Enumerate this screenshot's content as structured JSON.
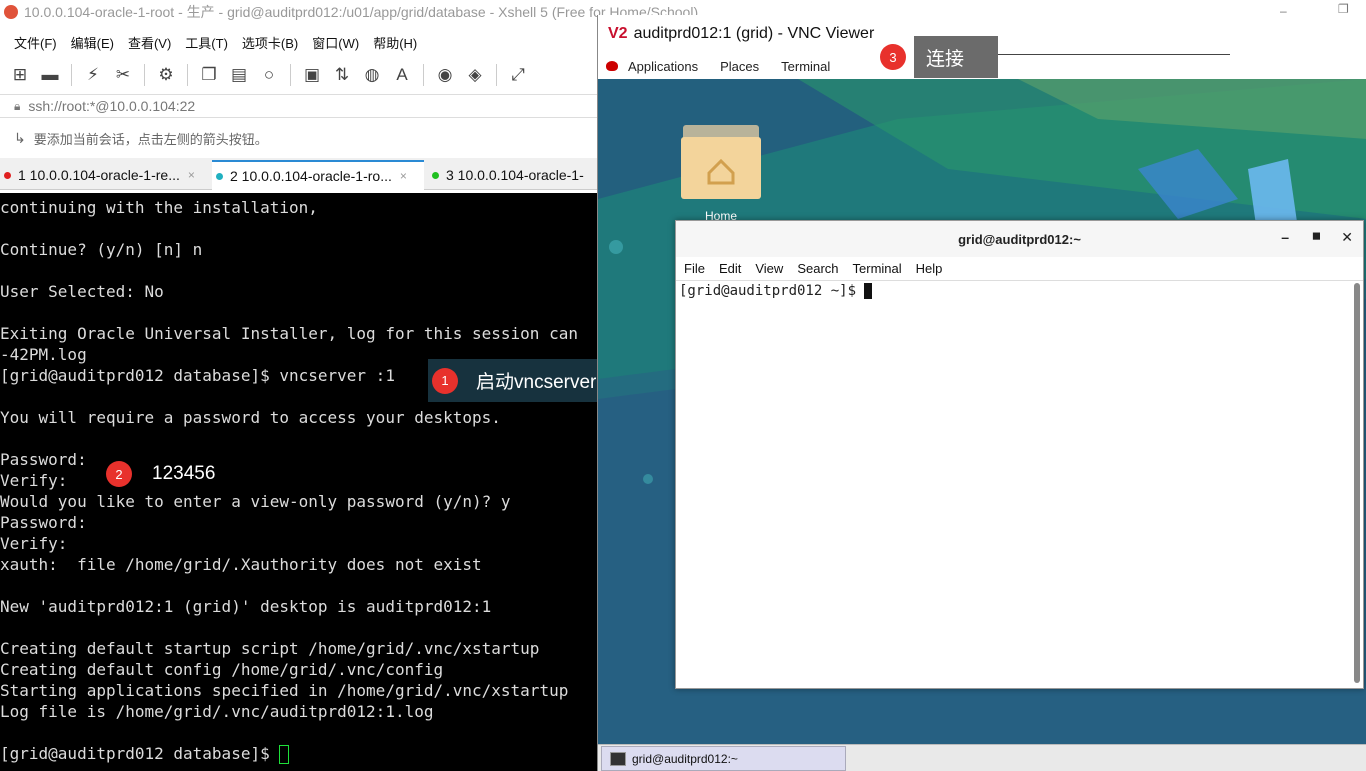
{
  "xshell": {
    "title": "10.0.0.104-oracle-1-root - 生产 - grid@auditprd012:/u01/app/grid/database - Xshell 5 (Free for Home/School)",
    "menu": [
      "文件(F)",
      "编辑(E)",
      "查看(V)",
      "工具(T)",
      "选项卡(B)",
      "窗口(W)",
      "帮助(H)"
    ],
    "address": "ssh://root:*@10.0.0.104:22",
    "hint": "要添加当前会话，点击左侧的箭头按钮。",
    "tabs": [
      {
        "label": "1 10.0.0.104-oracle-1-re...",
        "dot_color": "#e02020",
        "active": false
      },
      {
        "label": "2 10.0.0.104-oracle-1-ro...",
        "dot_color": "#20b0c0",
        "active": true
      },
      {
        "label": "3 10.0.0.104-oracle-1-",
        "dot_color": "#20c020",
        "active": false
      }
    ],
    "terminal_lines": [
      "continuing with the installation,",
      "",
      "Continue? (y/n) [n] n",
      "",
      "User Selected: No",
      "",
      "Exiting Oracle Universal Installer, log for this session can",
      "-42PM.log",
      "[grid@auditprd012 database]$ vncserver :1",
      "",
      "You will require a password to access your desktops.",
      "",
      "Password:",
      "Verify:",
      "Would you like to enter a view-only password (y/n)? y",
      "Password:",
      "Verify:",
      "xauth:  file /home/grid/.Xauthority does not exist",
      "",
      "New 'auditprd012:1 (grid)' desktop is auditprd012:1",
      "",
      "Creating default startup script /home/grid/.vnc/xstartup",
      "Creating default config /home/grid/.vnc/config",
      "Starting applications specified in /home/grid/.vnc/xstartup",
      "Log file is /home/grid/.vnc/auditprd012:1.log",
      "",
      "[grid@auditprd012 database]$ "
    ]
  },
  "annotations": {
    "a1": {
      "num": "1",
      "text": "启动vncserver"
    },
    "a2": {
      "num": "2",
      "text": "123456"
    },
    "a3": {
      "num": "3",
      "text": "连接"
    }
  },
  "vnc": {
    "title": "auditprd012:1 (grid) - VNC Viewer",
    "logo": "V2",
    "panel": [
      "Applications",
      "Places",
      "Terminal"
    ],
    "desktop_icon": "Home",
    "terminal": {
      "title": "grid@auditprd012:~",
      "menu": [
        "File",
        "Edit",
        "View",
        "Search",
        "Terminal",
        "Help"
      ],
      "prompt": "[grid@auditprd012 ~]$ "
    },
    "taskbar_item": "grid@auditprd012:~"
  }
}
